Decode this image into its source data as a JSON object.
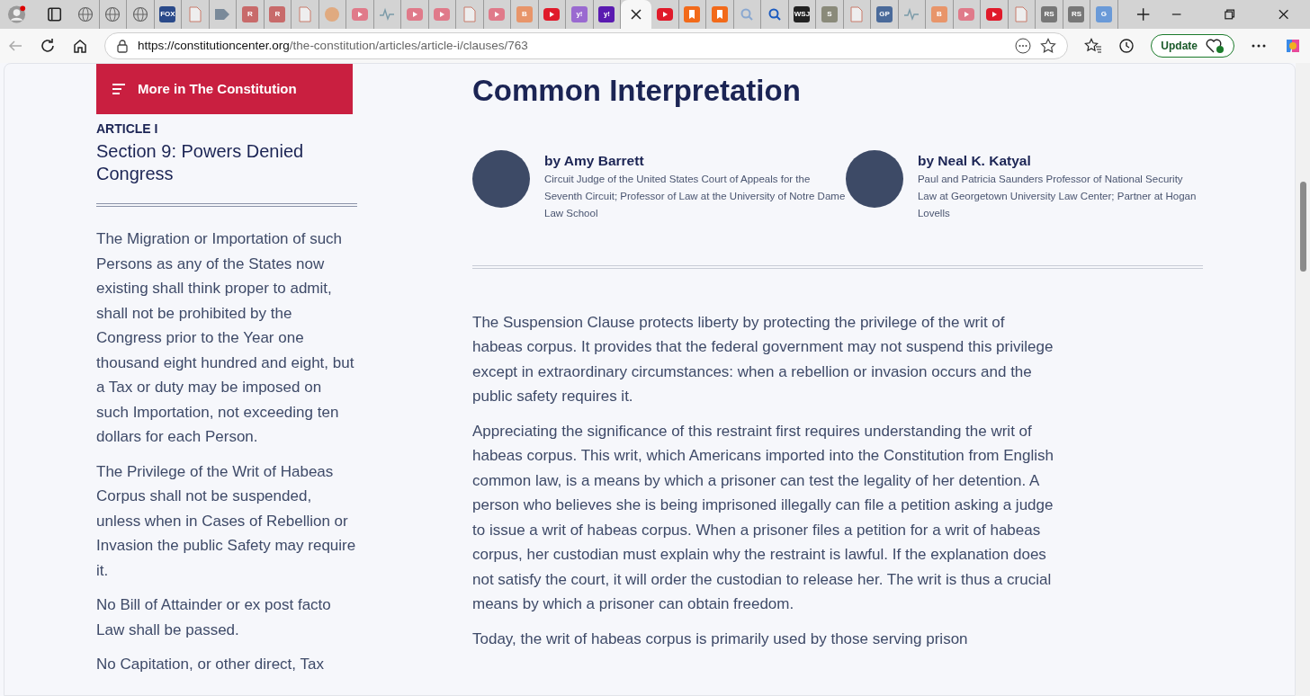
{
  "browser": {
    "tabs": [
      {
        "kind": "globe",
        "selected": false
      },
      {
        "kind": "globe",
        "selected": false
      },
      {
        "kind": "globe",
        "selected": false
      },
      {
        "kind": "square",
        "glyph": "FOX",
        "color": "#2a4a8a",
        "selected": false
      },
      {
        "kind": "doc",
        "selected": false
      },
      {
        "kind": "arrow",
        "selected": false
      },
      {
        "kind": "square",
        "glyph": "R",
        "color": "#c86a6a",
        "selected": false
      },
      {
        "kind": "square",
        "glyph": "R",
        "color": "#c86a6a",
        "selected": false
      },
      {
        "kind": "doc",
        "selected": false
      },
      {
        "kind": "circle",
        "selected": false
      },
      {
        "kind": "play",
        "color": "#e07a8a",
        "selected": false
      },
      {
        "kind": "pulse",
        "selected": false
      },
      {
        "kind": "play",
        "color": "#e07a8a",
        "selected": false
      },
      {
        "kind": "play",
        "color": "#e07a8a",
        "selected": false
      },
      {
        "kind": "doc",
        "selected": false
      },
      {
        "kind": "play",
        "color": "#e07a8a",
        "selected": false
      },
      {
        "kind": "square",
        "glyph": "B",
        "color": "#e8956a",
        "selected": false
      },
      {
        "kind": "play",
        "color": "#e01a2a",
        "selected": false
      },
      {
        "kind": "square",
        "glyph": "y!",
        "color": "#9a6ad0",
        "selected": false
      },
      {
        "kind": "square",
        "glyph": "y!",
        "color": "#5a1ab0",
        "selected": false
      },
      {
        "kind": "close",
        "selected": true
      },
      {
        "kind": "play",
        "color": "#e01a2a",
        "selected": false
      },
      {
        "kind": "bookmark",
        "color": "#f26a1a",
        "selected": false
      },
      {
        "kind": "bookmark",
        "color": "#f26a1a",
        "selected": false
      },
      {
        "kind": "search",
        "color": "#8aa8d0",
        "selected": false
      },
      {
        "kind": "search",
        "color": "#1a5ac0",
        "selected": false
      },
      {
        "kind": "square",
        "glyph": "WSJ",
        "color": "#222222",
        "selected": false
      },
      {
        "kind": "square",
        "glyph": "S",
        "color": "#8a8a7a",
        "selected": false
      },
      {
        "kind": "doc",
        "selected": false
      },
      {
        "kind": "square",
        "glyph": "GP",
        "color": "#4a6a9a",
        "selected": false
      },
      {
        "kind": "pulse",
        "selected": false
      },
      {
        "kind": "square",
        "glyph": "B",
        "color": "#e8956a",
        "selected": false
      },
      {
        "kind": "play",
        "color": "#e07a8a",
        "selected": false
      },
      {
        "kind": "play",
        "color": "#e01a2a",
        "selected": false
      },
      {
        "kind": "doc",
        "selected": false
      },
      {
        "kind": "square",
        "glyph": "RS",
        "color": "#777777",
        "selected": false
      },
      {
        "kind": "square",
        "glyph": "RS",
        "color": "#777777",
        "selected": false
      },
      {
        "kind": "square",
        "glyph": "G",
        "color": "#6a9ad8",
        "selected": false
      }
    ],
    "url_host": "https://constitutioncenter.org",
    "url_path": "/the-constitution/articles/article-i/clauses/763",
    "update_button": "Update"
  },
  "sidebar": {
    "menu_button": "More in The Constitution",
    "article": "ARTICLE I",
    "section_title": "Section 9: Powers Denied Congress",
    "paragraphs": [
      "The Migration or Importation of such Persons as any of the States now existing shall think proper to admit, shall not be prohibited by the Congress prior to the Year one thousand eight hundred and eight, but a Tax or duty may be imposed on such Importation, not exceeding ten dollars for each Person.",
      "The Privilege of the Writ of Habeas Corpus shall not be suspended, unless when in Cases of Rebellion or Invasion the public Safety may require it.",
      "No Bill of Attainder or ex post facto Law shall be passed.",
      "No Capitation, or other direct, Tax"
    ]
  },
  "main": {
    "heading": "Common Interpretation",
    "authors": [
      {
        "byline": "by Amy Barrett",
        "bio": "Circuit Judge of the United States Court of Appeals for the Seventh Circuit; Professor of Law at the University of Notre Dame Law School"
      },
      {
        "byline": "by Neal K. Katyal",
        "bio": "Paul and Patricia Saunders Professor of National Security Law at Georgetown University Law Center; Partner at Hogan Lovells"
      }
    ],
    "paragraphs": [
      "The Suspension Clause protects liberty by protecting the privilege of the writ of habeas corpus. It provides that the federal government may not suspend this privilege except in extraordinary circumstances: when a rebellion or invasion occurs and the public safety requires it.",
      "Appreciating the significance of this restraint first requires understanding the writ of habeas corpus. This writ, which Americans imported into the Constitution from English common law, is a means by which a prisoner can test the legality of her detention. A person who believes she is being imprisoned illegally can file a petition asking a judge to issue a writ of habeas corpus. When a prisoner files a petition for a writ of habeas corpus, her custodian must explain why the restraint is lawful. If the explanation does not satisfy the court, it will order the custodian to release her. The writ is thus a crucial means by which a prisoner can obtain freedom.",
      "Today, the writ of habeas corpus is primarily used by those serving prison"
    ]
  }
}
